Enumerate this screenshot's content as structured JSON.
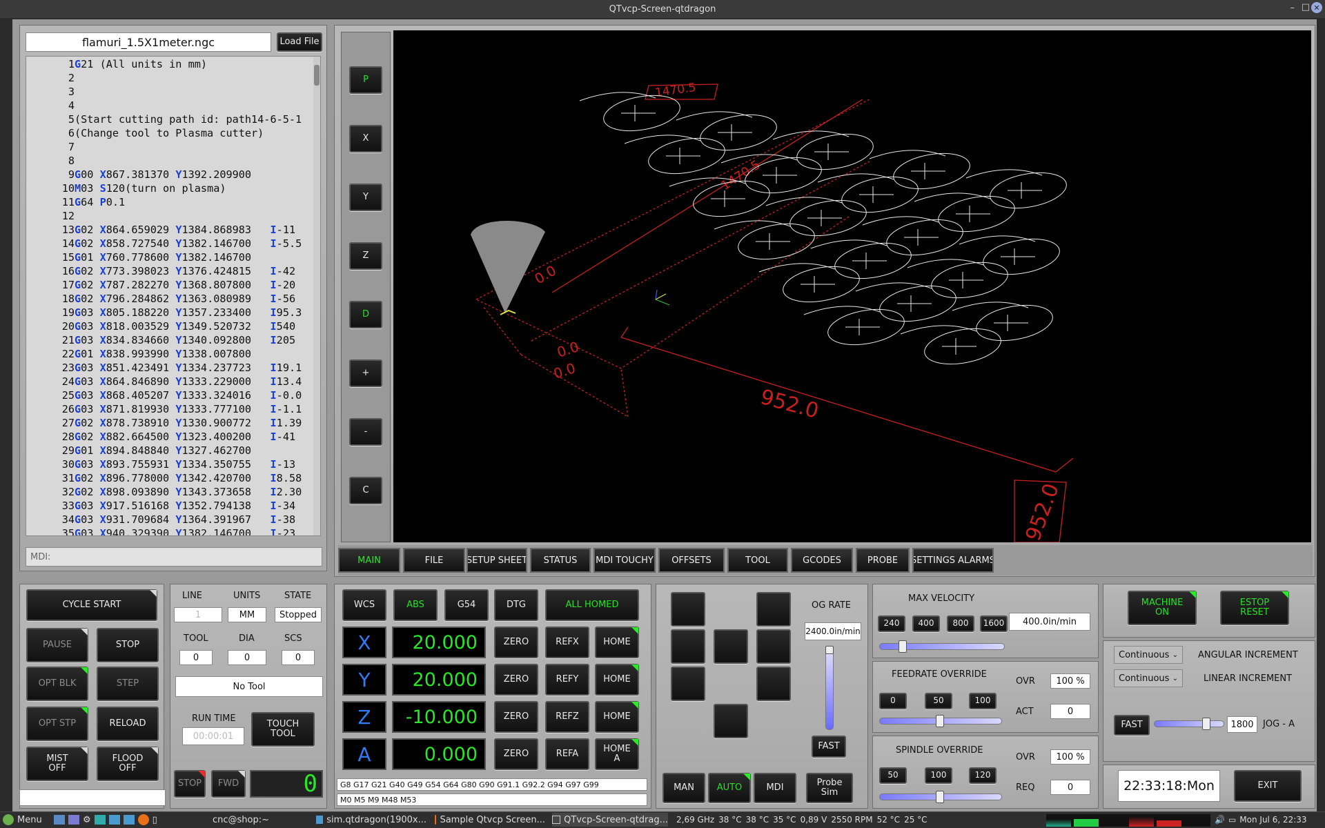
{
  "window": {
    "title": "QTvcp-Screen-qtdragon"
  },
  "file": {
    "name": "flamuri_1.5X1meter.ngc",
    "load_label": "Load File"
  },
  "gcode_lines": [
    {
      "n": "1",
      "t": "G21 (All units in mm)"
    },
    {
      "n": "2",
      "t": ""
    },
    {
      "n": "3",
      "t": ""
    },
    {
      "n": "4",
      "t": ""
    },
    {
      "n": "5",
      "t": "(Start cutting path id: path14-6-5-1"
    },
    {
      "n": "6",
      "t": "(Change tool to Plasma cutter)"
    },
    {
      "n": "7",
      "t": ""
    },
    {
      "n": "8",
      "t": ""
    },
    {
      "n": "9",
      "t": "G00 X867.381370 Y1392.209900"
    },
    {
      "n": "10",
      "t": "M03 S120(turn on plasma)"
    },
    {
      "n": "11",
      "t": "G64 P0.1"
    },
    {
      "n": "12",
      "t": ""
    },
    {
      "n": "13",
      "t": "G02 X864.659029 Y1384.868983   I-11"
    },
    {
      "n": "14",
      "t": "G02 X858.727540 Y1382.146700   I-5.5"
    },
    {
      "n": "15",
      "t": "G01 X760.778600 Y1382.146700"
    },
    {
      "n": "16",
      "t": "G02 X773.398023 Y1376.424815   I-42"
    },
    {
      "n": "17",
      "t": "G02 X787.282270 Y1368.807800   I-20"
    },
    {
      "n": "18",
      "t": "G02 X796.284862 Y1363.080989   I-56"
    },
    {
      "n": "19",
      "t": "G03 X805.188220 Y1357.233400   I95.3"
    },
    {
      "n": "20",
      "t": "G03 X818.003529 Y1349.520732   I540"
    },
    {
      "n": "21",
      "t": "G03 X834.834660 Y1340.092800   I205"
    },
    {
      "n": "22",
      "t": "G01 X838.993990 Y1338.007800"
    },
    {
      "n": "23",
      "t": "G03 X851.423491 Y1334.237723   I19.1"
    },
    {
      "n": "24",
      "t": "G03 X864.846890 Y1333.229000   I13.4"
    },
    {
      "n": "25",
      "t": "G03 X868.405207 Y1333.324016   I-0.0"
    },
    {
      "n": "26",
      "t": "G03 X871.819930 Y1333.777100   I-1.1"
    },
    {
      "n": "27",
      "t": "G02 X878.738910 Y1330.900772   I1.39"
    },
    {
      "n": "28",
      "t": "G02 X882.664500 Y1323.400200   I-41"
    },
    {
      "n": "29",
      "t": "G01 X894.848840 Y1327.462700"
    },
    {
      "n": "30",
      "t": "G03 X893.755931 Y1334.350755   I-13"
    },
    {
      "n": "31",
      "t": "G02 X896.778000 Y1342.420700   I8.58"
    },
    {
      "n": "32",
      "t": "G02 X898.093890 Y1343.373658   I2.30"
    },
    {
      "n": "33",
      "t": "G03 X917.516168 Y1352.794138   I-34"
    },
    {
      "n": "34",
      "t": "G03 X931.709684 Y1364.391967   I-38"
    },
    {
      "n": "35",
      "t": "G03 X940.329390 Y1382.146700   I-23"
    }
  ],
  "mdi": {
    "placeholder": "MDI:"
  },
  "side_buttons": [
    "P",
    "X",
    "Y",
    "Z",
    "D",
    "+",
    "-",
    "C"
  ],
  "preview": {
    "dim_top": "1470.5",
    "dim_diag": "1470.5",
    "dim_width": "952.0",
    "dim_right": "952.0",
    "zero_a": "0.0",
    "zero_b": "0.0",
    "zero_c": "0.0"
  },
  "tabs": [
    "MAIN",
    "FILE",
    "SETUP SHEET",
    "STATUS",
    "MDI TOUCHY",
    "OFFSETS",
    "TOOL",
    "GCODES",
    "PROBE",
    "SETTINGS ALARMS"
  ],
  "controls": {
    "cycle_start": "CYCLE  START",
    "pause": "PAUSE",
    "stop": "STOP",
    "opt_blk": "OPT BLK",
    "step": "STEP",
    "opt_stp": "OPT STP",
    "reload": "RELOAD",
    "mist": "MIST\nOFF",
    "flood": "FLOOD\nOFF"
  },
  "status": {
    "line_lbl": "LINE",
    "line_val": "1",
    "units_lbl": "UNITS",
    "units_val": "MM",
    "state_lbl": "STATE",
    "state_val": "Stopped",
    "tool_lbl": "TOOL",
    "tool_val": "0",
    "dia_lbl": "DIA",
    "dia_val": "0",
    "scs_lbl": "SCS",
    "scs_val": "0",
    "tool_name": "No Tool",
    "runtime_lbl": "RUN TIME",
    "runtime_val": "00:00:01",
    "touch_tool": "TOUCH\nTOOL",
    "stop_btn": "STOP",
    "fwd_btn": "FWD",
    "spindle_digit": "0"
  },
  "dro": {
    "wcs": "WCS",
    "abs": "ABS",
    "g54": "G54",
    "dtg": "DTG",
    "all_homed": "ALL HOMED",
    "axes": [
      {
        "name": "X",
        "value": "20.000",
        "ref": "REFX",
        "home": "HOME"
      },
      {
        "name": "Y",
        "value": "20.000",
        "ref": "REFY",
        "home": "HOME"
      },
      {
        "name": "Z",
        "value": "-10.000",
        "ref": "REFZ",
        "home": "HOME"
      },
      {
        "name": "A",
        "value": "0.000",
        "ref": "REFA",
        "home": "HOME\nA"
      }
    ],
    "zero": "ZERO",
    "gcodes_active": "G8 G17 G21 G40 G49 G54 G64 G80 G90 G91.1 G92.2 G94 G97 G99",
    "mcodes_active": "M0 M5 M9 M48 M53"
  },
  "jog": {
    "rate_lbl": "OG RATE",
    "rate_val": "2400.0in/min",
    "fast": "FAST",
    "man": "MAN",
    "auto": "AUTO",
    "mdi": "MDI",
    "probe_sim": "Probe\nSim"
  },
  "velocity": {
    "title": "MAX VELOCITY",
    "presets": [
      "240",
      "400",
      "800",
      "1600"
    ],
    "value": "400.0in/min",
    "slider_fraction": 0.2
  },
  "feed": {
    "title": "FEEDRATE OVERRIDE",
    "presets": [
      "0",
      "50",
      "100"
    ],
    "ovr_lbl": "OVR",
    "ovr_val": "100 %",
    "act_lbl": "ACT",
    "act_val": "0",
    "slider_fraction": 0.5
  },
  "spindle": {
    "title": "SPINDLE OVERRIDE",
    "presets": [
      "50",
      "100",
      "120"
    ],
    "ovr_lbl": "OVR",
    "ovr_val": "100 %",
    "req_lbl": "REQ",
    "req_val": "0",
    "slider_fraction": 0.5
  },
  "machine": {
    "on": "MACHINE\nON",
    "estop": "ESTOP\nRESET"
  },
  "increments": {
    "angular_sel": "Continuous",
    "angular_lbl": "ANGULAR INCREMENT",
    "linear_sel": "Continuous",
    "linear_lbl": "LINEAR INCREMENT",
    "fast": "FAST",
    "jog_val": "1800",
    "jog_lbl": "JOG - A",
    "slider_fraction": 0.8
  },
  "clock": "22:33:18:Mon",
  "exit": "EXIT",
  "taskbar": {
    "menu": "Menu",
    "terminal": "cnc@shop:~",
    "items": [
      "sim.qtdragon(1900x...",
      "Sample Qtvcp Screen...",
      "QTvcp-Screen-qtdrag..."
    ],
    "cpu": "2,69 GHz",
    "t1": "38 °C",
    "t2": "38 °C",
    "t3": "35 °C",
    "volt": "0,89 V",
    "rpm": "2550 RPM",
    "t4": "52 °C",
    "t5": "25 °C",
    "datetime": "Mon Jul  6, 22:33"
  },
  "colors": {
    "dro_green": "#28e628",
    "axis_blue": "#2e7cf6",
    "led_green": "#2ee82e",
    "led_red": "#e83030",
    "preview_red": "#d02020"
  }
}
